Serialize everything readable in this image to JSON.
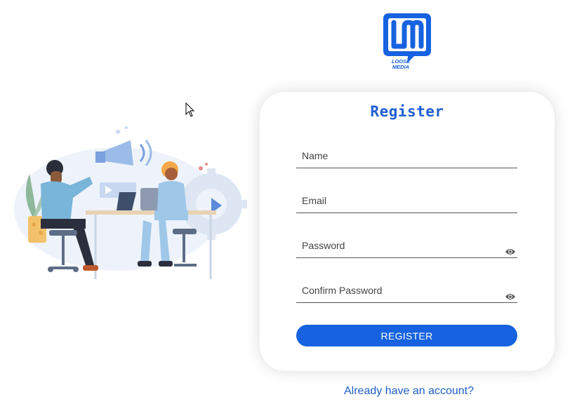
{
  "brand": {
    "logo_line1": "LOOSE",
    "logo_line2": "MEDIA",
    "monogram": "LM",
    "color": "#1662e0"
  },
  "form": {
    "title": "Register",
    "fields": {
      "name": {
        "placeholder": "Name"
      },
      "email": {
        "placeholder": "Email"
      },
      "password": {
        "placeholder": "Password",
        "toggle_icon": "eye-icon"
      },
      "confirm_password": {
        "placeholder": "Confirm Password",
        "toggle_icon": "eye-icon"
      }
    },
    "submit_label": "REGISTER",
    "login_link": "Already have an account?"
  },
  "colors": {
    "accent": "#1662e0",
    "title": "#1f5fd3",
    "link": "#1f5fc4"
  }
}
